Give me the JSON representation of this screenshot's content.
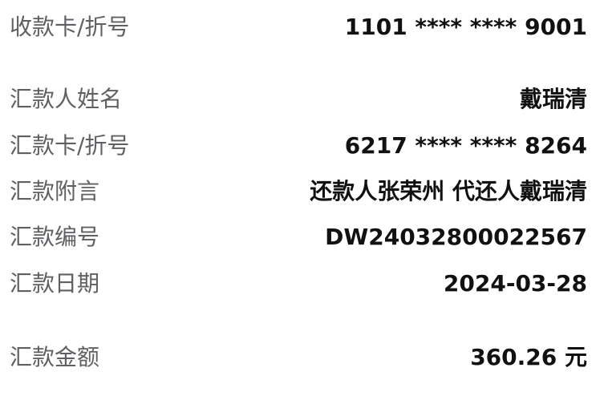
{
  "receipt": {
    "rows": [
      {
        "label": "收款卡/折号",
        "value": "1101 **** **** 9001"
      },
      {
        "label": "汇款人姓名",
        "value": "戴瑞清"
      },
      {
        "label": "汇款卡/折号",
        "value": "6217 **** **** 8264"
      },
      {
        "label": "汇款附言",
        "value": "还款人张荣州 代还人戴瑞清"
      },
      {
        "label": "汇款编号",
        "value": "DW24032800022567"
      },
      {
        "label": "汇款日期",
        "value": "2024-03-28"
      },
      {
        "label": "汇款金额",
        "value": "360.26 元"
      }
    ]
  }
}
